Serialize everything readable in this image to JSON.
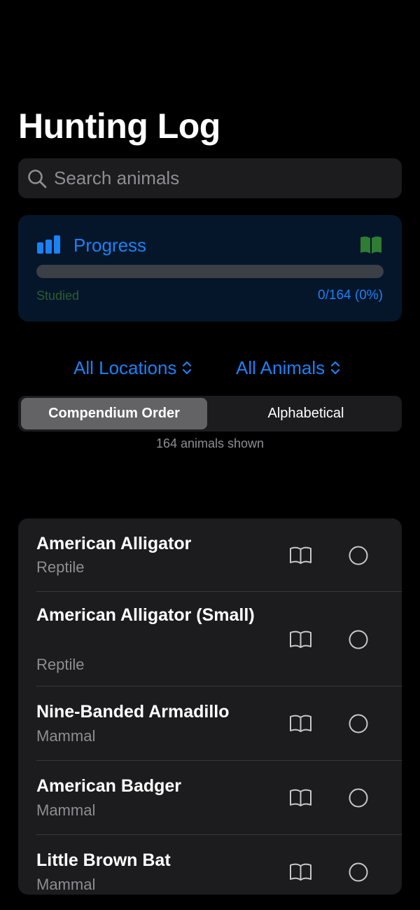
{
  "title": "Hunting Log",
  "search": {
    "placeholder": "Search animals",
    "icon": "magnifying-glass-icon"
  },
  "progress": {
    "title": "Progress",
    "studied_label": "Studied",
    "count_text": "0/164 (0%)",
    "fraction": 0,
    "left_icon": "chart-bars-icon",
    "right_icon": "book-filled-icon"
  },
  "filters": {
    "location": "All Locations",
    "animals": "All Animals",
    "chevron_icon": "chevron-up-down-icon"
  },
  "sort": {
    "options": [
      "Compendium Order",
      "Alphabetical"
    ],
    "selected": "Compendium Order"
  },
  "shown_text": "164 animals shown",
  "animals": [
    {
      "name": "American Alligator",
      "type": "Reptile"
    },
    {
      "name": "American Alligator (Small)",
      "type": "Reptile"
    },
    {
      "name": "Nine-Banded Armadillo",
      "type": "Mammal"
    },
    {
      "name": "American Badger",
      "type": "Mammal"
    },
    {
      "name": "Little Brown Bat",
      "type": "Mammal"
    }
  ],
  "colors": {
    "accent": "#1a82f7",
    "background": "#000000",
    "card": "#1c1c1e",
    "progress_card": "#06162a",
    "secondary_text": "#8d8d93",
    "studied_label": "#2e5c30",
    "book_filled": "#2e7d32"
  }
}
